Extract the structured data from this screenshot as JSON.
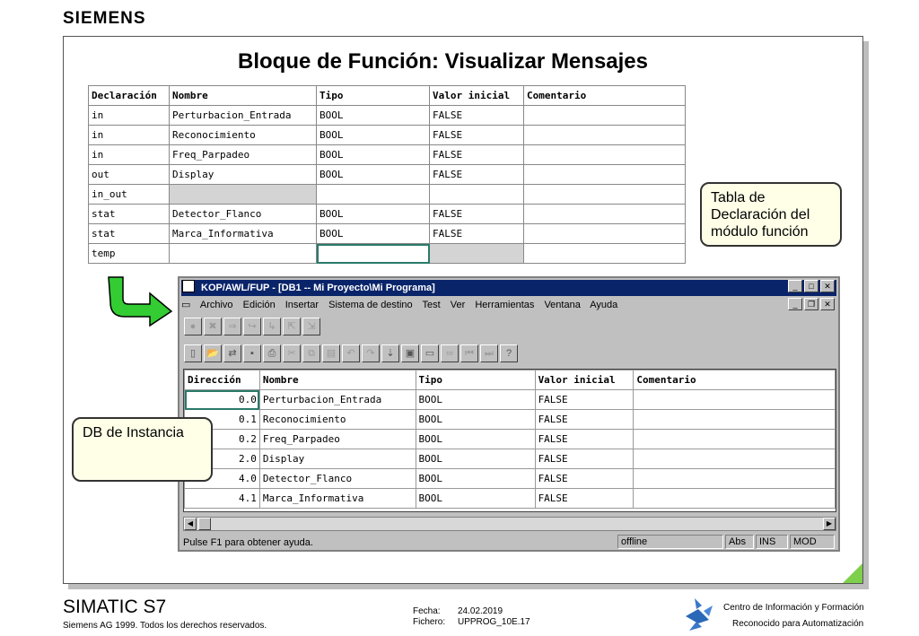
{
  "brand": "SIEMENS",
  "slide_title": "Bloque de Función: Visualizar Mensajes",
  "declaration_table": {
    "headers": [
      "Declaración",
      "Nombre",
      "Tipo",
      "Valor inicial",
      "Comentario"
    ],
    "rows": [
      [
        "in",
        "Perturbacion_Entrada",
        "BOOL",
        "FALSE",
        ""
      ],
      [
        "in",
        "Reconocimiento",
        "BOOL",
        "FALSE",
        ""
      ],
      [
        "in",
        "Freq_Parpadeo",
        "BOOL",
        "FALSE",
        ""
      ],
      [
        "out",
        "Display",
        "BOOL",
        "FALSE",
        ""
      ],
      [
        "in_out",
        "",
        "",
        "",
        ""
      ],
      [
        "stat",
        "Detector_Flanco",
        "BOOL",
        "FALSE",
        ""
      ],
      [
        "stat",
        "Marca_Informativa",
        "BOOL",
        "FALSE",
        ""
      ],
      [
        "temp",
        "",
        "",
        "",
        ""
      ]
    ]
  },
  "callouts": {
    "decl": "Tabla de Declaración del módulo función",
    "instance": "DB  de Instancia"
  },
  "window": {
    "title": "KOP/AWL/FUP  - [DB1 -- Mi Proyecto\\Mi Programa]",
    "menu": [
      "Archivo",
      "Edición",
      "Insertar",
      "Sistema de destino",
      "Test",
      "Ver",
      "Herramientas",
      "Ventana",
      "Ayuda"
    ],
    "table_headers": [
      "Dirección",
      "Nombre",
      "Tipo",
      "Valor inicial",
      "Comentario"
    ],
    "rows": [
      [
        "0.0",
        "Perturbacion_Entrada",
        "BOOL",
        "FALSE",
        ""
      ],
      [
        "0.1",
        "Reconocimiento",
        "BOOL",
        "FALSE",
        ""
      ],
      [
        "0.2",
        "Freq_Parpadeo",
        "BOOL",
        "FALSE",
        ""
      ],
      [
        "2.0",
        "Display",
        "BOOL",
        "FALSE",
        ""
      ],
      [
        "4.0",
        "Detector_Flanco",
        "BOOL",
        "FALSE",
        ""
      ],
      [
        "4.1",
        "Marca_Informativa",
        "BOOL",
        "FALSE",
        ""
      ]
    ],
    "status_text": "Pulse F1 para obtener ayuda.",
    "status_mode": "offline",
    "status_abs": "Abs",
    "status_ins": "INS",
    "status_mod": "MOD"
  },
  "footer": {
    "product": "SIMATIC S7",
    "copyright": "Siemens AG 1999. Todos los derechos reservados.",
    "date_label": "Fecha:",
    "date_value": "24.02.2019",
    "file_label": "Fichero:",
    "file_value": "UPPROG_10E.17",
    "center_line1": "Centro de Información y Formación",
    "center_line2": "Reconocido para Automatización"
  },
  "colors": {
    "title_bar": "#0a246a",
    "arrow": "#33cc33",
    "corner": "#7ecf4a"
  }
}
